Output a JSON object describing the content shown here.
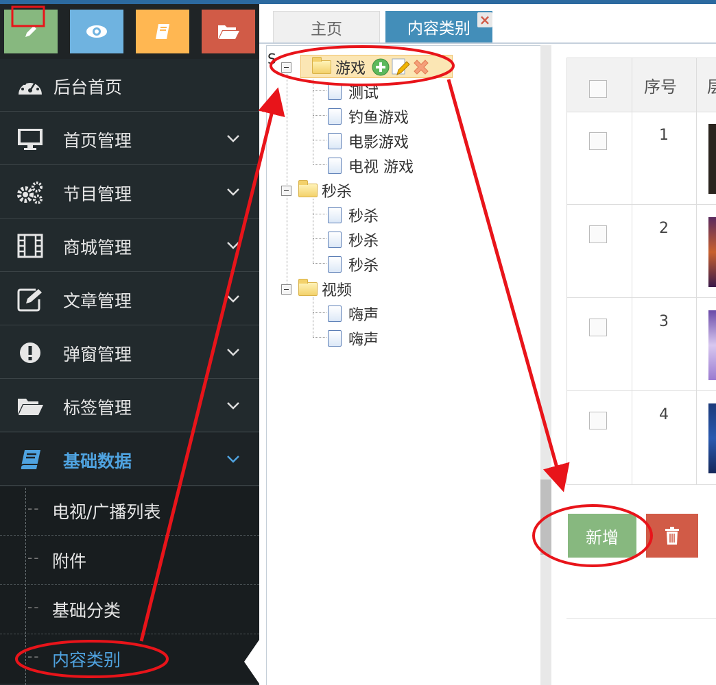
{
  "shortcuts": [
    {
      "icon": "pencil-icon",
      "color": "#87b87f"
    },
    {
      "icon": "eye-icon",
      "color": "#6fb3e0"
    },
    {
      "icon": "book-icon",
      "color": "#ffb752"
    },
    {
      "icon": "folder-open-icon",
      "color": "#d15b47"
    }
  ],
  "sidebar": {
    "items": [
      {
        "label": "后台首页",
        "icon": "dashboard-icon"
      },
      {
        "label": "首页管理",
        "icon": "desktop-icon"
      },
      {
        "label": "节目管理",
        "icon": "cogs-icon"
      },
      {
        "label": "商城管理",
        "icon": "film-icon"
      },
      {
        "label": "文章管理",
        "icon": "edit-icon"
      },
      {
        "label": "弹窗管理",
        "icon": "exclamation-icon"
      },
      {
        "label": "标签管理",
        "icon": "folder-open-icon"
      },
      {
        "label": "基础数据",
        "icon": "book-icon",
        "active": true
      }
    ],
    "subitems": [
      {
        "label": "电视/广播列表"
      },
      {
        "label": "附件"
      },
      {
        "label": "基础分类"
      },
      {
        "label": "内容类别",
        "active": true
      }
    ],
    "dash": "--"
  },
  "tabs": [
    {
      "label": "主页"
    },
    {
      "label": "内容类别",
      "active": true,
      "close": "×"
    }
  ],
  "tree": {
    "lead_char": "S",
    "groups": [
      {
        "label": "游戏",
        "children": [
          "测试",
          "钓鱼游戏",
          "电影游戏",
          "电视 游戏"
        ]
      },
      {
        "label": "秒杀",
        "children": [
          "秒杀",
          "秒杀",
          "秒杀"
        ]
      },
      {
        "label": "视频",
        "children": [
          "嗨声",
          "嗨声"
        ]
      }
    ]
  },
  "table": {
    "headers": [
      "序号",
      "层"
    ],
    "rows": [
      {
        "num": "1",
        "thumb_color": "#2a241e"
      },
      {
        "num": "2",
        "thumb_color": "#7a3a2e"
      },
      {
        "num": "3",
        "thumb_color": "#8a6ab8"
      },
      {
        "num": "4",
        "thumb_color": "#1c3a7a"
      }
    ]
  },
  "buttons": {
    "add": "新增"
  },
  "colors": {
    "accent": "#2c6aa0",
    "annotation": "#e8141a"
  }
}
